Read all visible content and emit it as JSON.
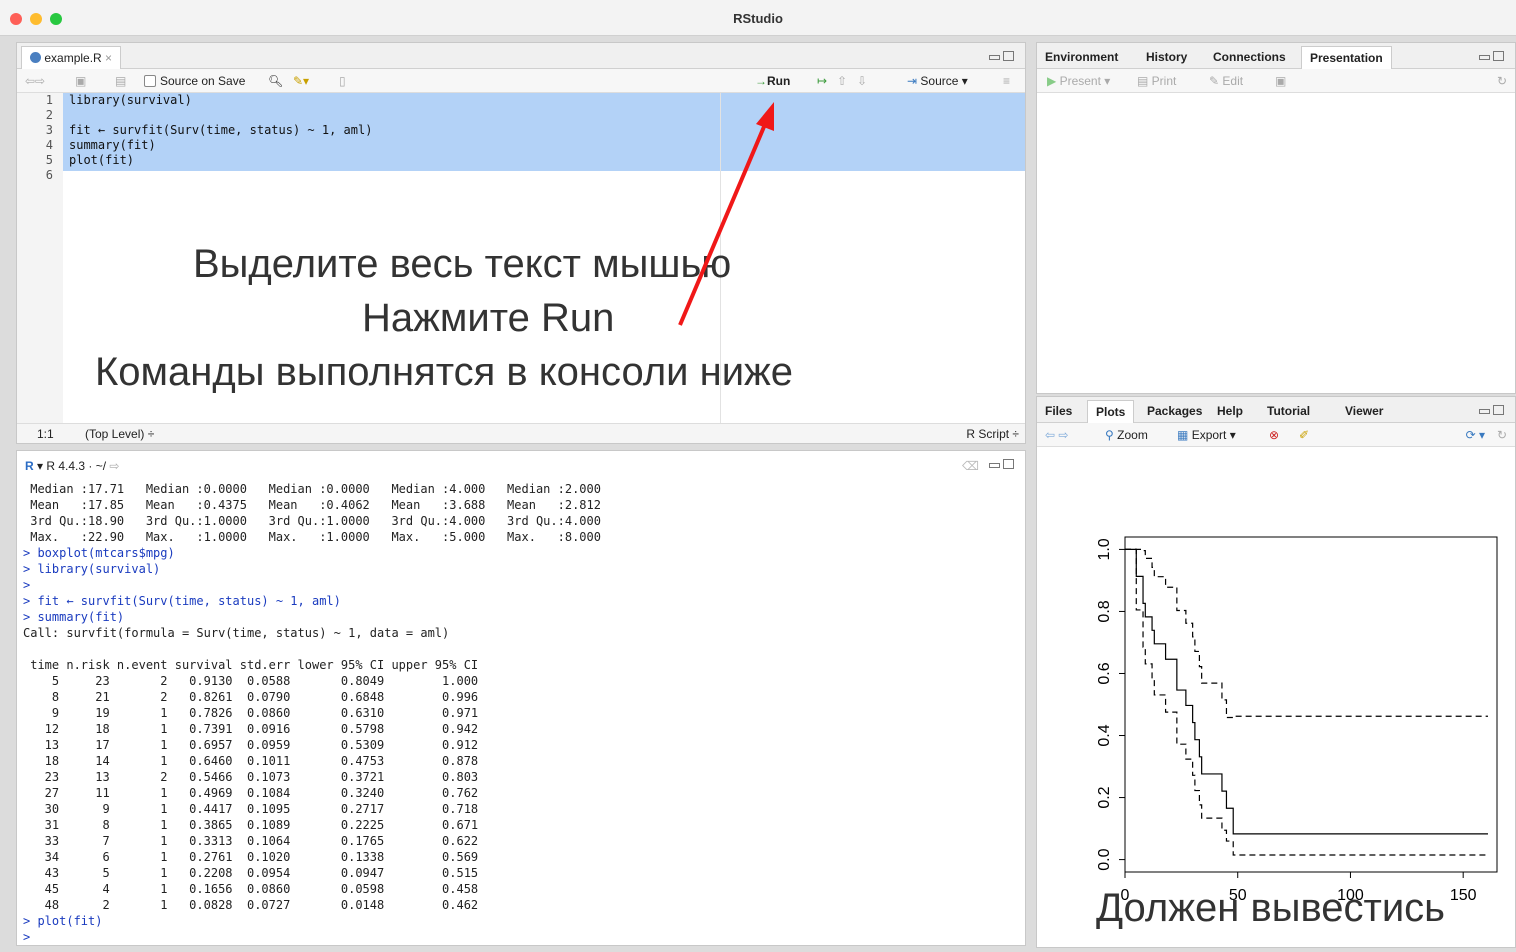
{
  "app": {
    "title": "RStudio"
  },
  "editor": {
    "tab": "example.R",
    "toolbar": {
      "source_on_save": "Source on Save",
      "run": "Run",
      "source": "Source"
    },
    "lines": [
      "library(survival)",
      "",
      "fit ← survfit(Surv(time, status) ~ 1, aml)",
      "summary(fit)",
      "plot(fit)",
      ""
    ],
    "line_numbers": [
      "1",
      "2",
      "3",
      "4",
      "5",
      "6"
    ],
    "status": {
      "position": "1:1",
      "scope": "(Top Level) ÷",
      "filetype": "R Script ÷"
    }
  },
  "annotation": {
    "line1": "Выделите весь текст мышью",
    "line2": "Нажмите Run",
    "line3": "Команды выполнятся в консоли ниже",
    "plot_note": "Должен вывестись"
  },
  "console": {
    "header": "R 4.4.3 · ~/",
    "lines": [
      {
        "t": " Median :17.71   Median :0.0000   Median :0.0000   Median :4.000   Median :2.000",
        "c": ""
      },
      {
        "t": " Mean   :17.85   Mean   :0.4375   Mean   :0.4062   Mean   :3.688   Mean   :2.812",
        "c": ""
      },
      {
        "t": " 3rd Qu.:18.90   3rd Qu.:1.0000   3rd Qu.:1.0000   3rd Qu.:4.000   3rd Qu.:4.000",
        "c": ""
      },
      {
        "t": " Max.   :22.90   Max.   :1.0000   Max.   :1.0000   Max.   :5.000   Max.   :8.000",
        "c": ""
      },
      {
        "t": "> boxplot(mtcars$mpg)",
        "c": "blue"
      },
      {
        "t": "> library(survival)",
        "c": "blue"
      },
      {
        "t": ">",
        "c": "blue"
      },
      {
        "t": "> fit ← survfit(Surv(time, status) ~ 1, aml)",
        "c": "blue"
      },
      {
        "t": "> summary(fit)",
        "c": "blue"
      },
      {
        "t": "Call: survfit(formula = Surv(time, status) ~ 1, data = aml)",
        "c": ""
      },
      {
        "t": "",
        "c": ""
      },
      {
        "t": " time n.risk n.event survival std.err lower 95% CI upper 95% CI",
        "c": ""
      },
      {
        "t": "    5     23       2   0.9130  0.0588       0.8049        1.000",
        "c": ""
      },
      {
        "t": "    8     21       2   0.8261  0.0790       0.6848        0.996",
        "c": ""
      },
      {
        "t": "    9     19       1   0.7826  0.0860       0.6310        0.971",
        "c": ""
      },
      {
        "t": "   12     18       1   0.7391  0.0916       0.5798        0.942",
        "c": ""
      },
      {
        "t": "   13     17       1   0.6957  0.0959       0.5309        0.912",
        "c": ""
      },
      {
        "t": "   18     14       1   0.6460  0.1011       0.4753        0.878",
        "c": ""
      },
      {
        "t": "   23     13       2   0.5466  0.1073       0.3721        0.803",
        "c": ""
      },
      {
        "t": "   27     11       1   0.4969  0.1084       0.3240        0.762",
        "c": ""
      },
      {
        "t": "   30      9       1   0.4417  0.1095       0.2717        0.718",
        "c": ""
      },
      {
        "t": "   31      8       1   0.3865  0.1089       0.2225        0.671",
        "c": ""
      },
      {
        "t": "   33      7       1   0.3313  0.1064       0.1765        0.622",
        "c": ""
      },
      {
        "t": "   34      6       1   0.2761  0.1020       0.1338        0.569",
        "c": ""
      },
      {
        "t": "   43      5       1   0.2208  0.0954       0.0947        0.515",
        "c": ""
      },
      {
        "t": "   45      4       1   0.1656  0.0860       0.0598        0.458",
        "c": ""
      },
      {
        "t": "   48      2       1   0.0828  0.0727       0.0148        0.462",
        "c": ""
      },
      {
        "t": "> plot(fit)",
        "c": "blue"
      },
      {
        "t": "> ",
        "c": "blue"
      }
    ]
  },
  "env_pane": {
    "tabs": [
      "Environment",
      "History",
      "Connections",
      "Presentation"
    ],
    "active": "Presentation",
    "toolbar": {
      "present": "Present",
      "print": "Print",
      "edit": "Edit"
    }
  },
  "files_pane": {
    "tabs": [
      "Files",
      "Plots",
      "Packages",
      "Help",
      "Tutorial",
      "Viewer"
    ],
    "active": "Plots",
    "toolbar": {
      "zoom": "Zoom",
      "export": "Export"
    }
  },
  "chart_data": {
    "type": "line",
    "title": "",
    "xlabel": "",
    "ylabel": "",
    "xlim": [
      0,
      160
    ],
    "ylim": [
      0,
      1
    ],
    "x_ticks": [
      "0",
      "50",
      "100",
      "150"
    ],
    "y_ticks": [
      "0.0",
      "0.2",
      "0.4",
      "0.6",
      "0.8",
      "1.0"
    ],
    "series": [
      {
        "style": "solid",
        "x": [
          0,
          5,
          8,
          9,
          12,
          13,
          18,
          23,
          27,
          30,
          31,
          33,
          34,
          43,
          45,
          48,
          161
        ],
        "y": [
          1,
          0.913,
          0.8261,
          0.7826,
          0.7391,
          0.6957,
          0.646,
          0.5466,
          0.4969,
          0.4417,
          0.3865,
          0.3313,
          0.2761,
          0.2208,
          0.1656,
          0.0828,
          0.0828
        ]
      },
      {
        "style": "dashed",
        "x": [
          0,
          5,
          8,
          9,
          12,
          13,
          18,
          23,
          27,
          30,
          31,
          33,
          34,
          43,
          45,
          48,
          161
        ],
        "y": [
          1,
          0.8049,
          0.6848,
          0.631,
          0.5798,
          0.5309,
          0.4753,
          0.3721,
          0.324,
          0.2717,
          0.2225,
          0.1765,
          0.1338,
          0.0947,
          0.0598,
          0.0148,
          0.0148
        ]
      },
      {
        "style": "dashed",
        "x": [
          0,
          5,
          8,
          9,
          12,
          13,
          18,
          23,
          27,
          30,
          31,
          33,
          34,
          43,
          45,
          48,
          161
        ],
        "y": [
          1,
          1,
          0.996,
          0.971,
          0.942,
          0.912,
          0.878,
          0.803,
          0.762,
          0.718,
          0.671,
          0.622,
          0.569,
          0.515,
          0.458,
          0.462,
          0.462
        ]
      }
    ]
  }
}
